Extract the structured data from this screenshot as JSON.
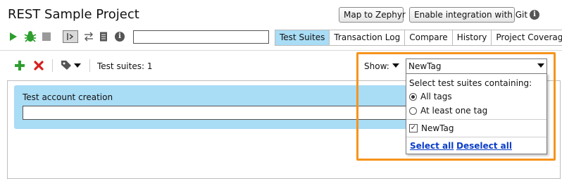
{
  "header": {
    "title": "REST Sample Project",
    "map_button": "Map to Zephyr",
    "git_button": "Enable integration with Git",
    "info_glyph": "i"
  },
  "toolbar": {
    "run_icon": "play-icon",
    "debug_icon": "bug-icon",
    "stop_icon": "stop-icon",
    "step_icon": "step-into-icon",
    "transfer_icon": "transfer-icon",
    "list_icon": "document-icon",
    "info_glyph": "i",
    "input_value": ""
  },
  "tabs": [
    {
      "label": "Test Suites",
      "active": true
    },
    {
      "label": "Transaction Log",
      "active": false
    },
    {
      "label": "Compare",
      "active": false
    },
    {
      "label": "History",
      "active": false
    },
    {
      "label": "Project Coverage",
      "active": false
    }
  ],
  "suites_toolbar": {
    "add_icon": "plus-icon",
    "delete_icon": "delete-icon",
    "tag_icon": "tag-icon",
    "count_label": "Test suites: 1",
    "show_label": "Show:",
    "filter_value": "NewTag"
  },
  "suite": {
    "name": "Test account creation",
    "input_value": ""
  },
  "dropdown": {
    "heading": "Select test suites containing:",
    "options": [
      {
        "label": "All tags",
        "selected": true
      },
      {
        "label": "At least one tag",
        "selected": false
      }
    ],
    "tags": [
      {
        "label": "NewTag",
        "checked": true
      }
    ],
    "select_all": "Select all",
    "deselect_all": "Deselect all"
  },
  "colors": {
    "accent": "#a9dcf5",
    "highlight": "#f7941d",
    "run_green": "#2e9e2e",
    "delete_red": "#d62020",
    "link_blue": "#0a3cc8"
  }
}
